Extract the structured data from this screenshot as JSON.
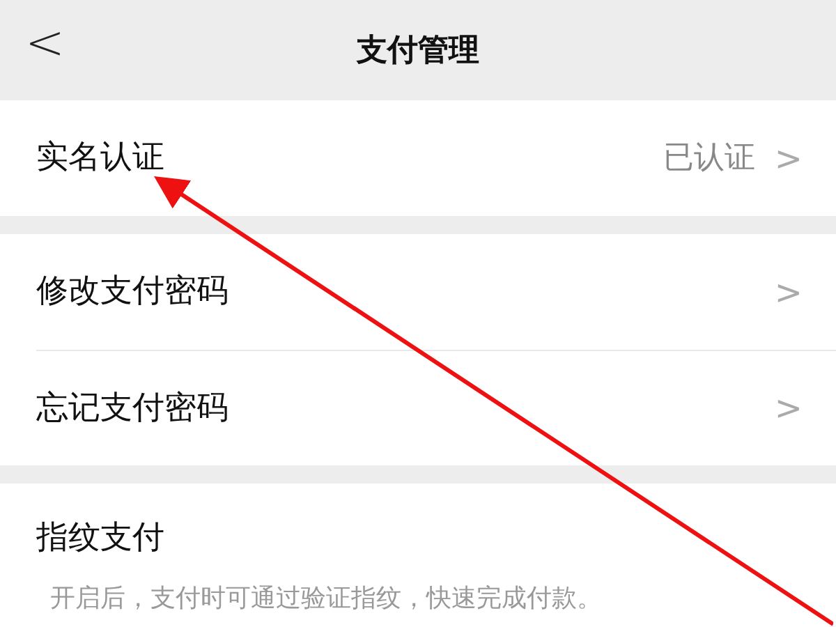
{
  "nav_bar": {
    "back": "<",
    "title": "支付管理"
  },
  "sections": [
    {
      "rows": [
        {
          "label": "实名认证",
          "value": "已认证",
          "chevron": ">"
        }
      ]
    },
    {
      "rows": [
        {
          "label": "修改支付密码",
          "chevron": ">"
        },
        {
          "label": "忘记支付密码",
          "chevron": ">"
        }
      ]
    }
  ],
  "fingerprint": {
    "label": "指纹支付",
    "description": "开启后，支付时可通过验证指纹，快速完成付款。"
  }
}
